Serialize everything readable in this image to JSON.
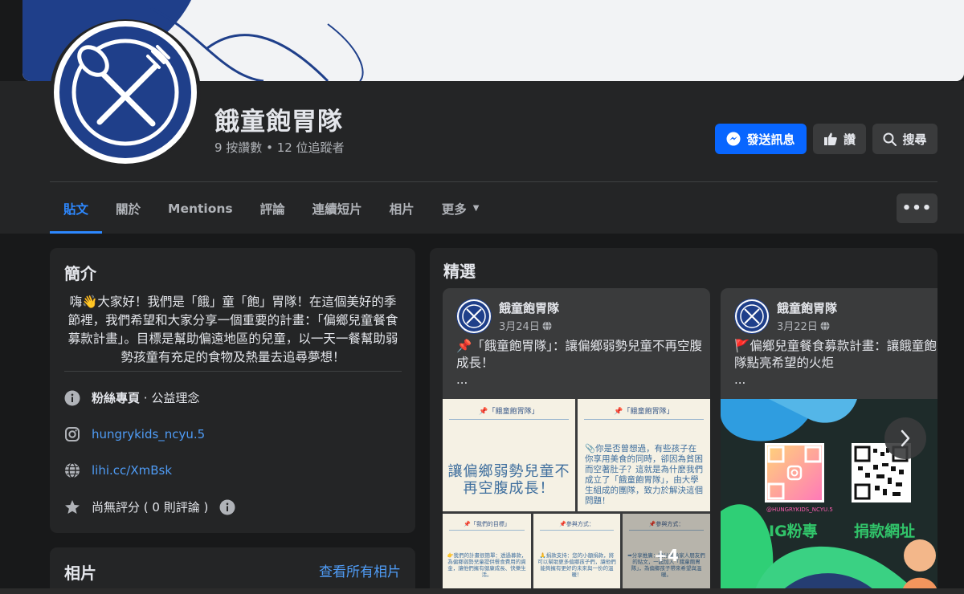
{
  "page": {
    "name": "餓童飽胃隊",
    "stats": "9 按讚數 • 12 位追蹤者"
  },
  "actions": {
    "message": "發送訊息",
    "like": "讚",
    "search": "搜尋"
  },
  "tabs": [
    {
      "label": "貼文",
      "active": true
    },
    {
      "label": "關於"
    },
    {
      "label": "Mentions"
    },
    {
      "label": "評論"
    },
    {
      "label": "連續短片"
    },
    {
      "label": "相片"
    },
    {
      "label": "更多"
    }
  ],
  "more_menu": "•••",
  "intro": {
    "title": "簡介",
    "text": "嗨👋大家好！我們是「餓」童「飽」胃隊！在這個美好的季節裡，我們希望和大家分享一個重要的計畫：「偏鄉兒童餐食募款計畫」。目標是幫助偏遠地區的兒童，以一天一餐幫助弱勢孩童有充足的食物及熱量去追尋夢想！",
    "category_bold": "粉絲專頁",
    "category_rest": " · 公益理念",
    "instagram": "hungrykids_ncyu.5",
    "website": "lihi.cc/XmBsk",
    "rating": "尚無評分 ( 0 則評論 )"
  },
  "photos": {
    "title": "相片",
    "see_all": "查看所有相片"
  },
  "featured": {
    "title": "精選",
    "posts": [
      {
        "author": "餓童飽胃隊",
        "date": "3月24日",
        "text": "📌「餓童飽胃隊」：讓偏鄉弱勢兒童不再空腹成長！",
        "ellipsis": "...",
        "img1_pin": "📌「餓童飽胃隊」",
        "img1_title": "讓偏鄉弱勢兒童不再空腹成長！",
        "img2_pin": "📌「餓童飽胃隊」",
        "img2_body": "📎你是否曾想過，有些孩子在你享用美食的同時，卻因為貧困而空著肚子？這就是為什麼我們成立了「餓童飽胃隊」，由大學生組成的團隊，致力於解決這個問題！",
        "img3_pin": "📌「我們的目標」",
        "img3_body": "👉我們的計畫很簡單：透過募款，為偏鄉弱勢兒童提供餐食費用的資金，讓他們擁有健康成長、快樂生活。",
        "img4_pin": "📌參與方式：",
        "img4_body": "🙏捐款支持：您的小額捐款，將可以幫助更多偏鄉孩子們，讓他們能夠擁有更好的未來與一份的溫暖！",
        "img5_pin": "📌參與方式：",
        "img5_body": "➡分享推廣：請分享給家人朋友們的貼文，一起加入「餓童飽胃隊」，為偏鄉孩子帶來希望與溫暖。",
        "more_count": "+4"
      },
      {
        "author": "餓童飽胃隊",
        "date": "3月22日",
        "text": "🚩偏鄉兒童餐食募款計畫：讓餓童飽胃隊點亮希望的火炬",
        "ellipsis": "...",
        "qr1_caption": "@HUNGRYKIDS_NCYU.5",
        "label_ig": "IG粉專",
        "label_donate": "捐款網址"
      }
    ]
  },
  "colors": {
    "primary": "#0866ff",
    "link": "#4f9cf6",
    "logo_blue": "#1f3f8a"
  }
}
